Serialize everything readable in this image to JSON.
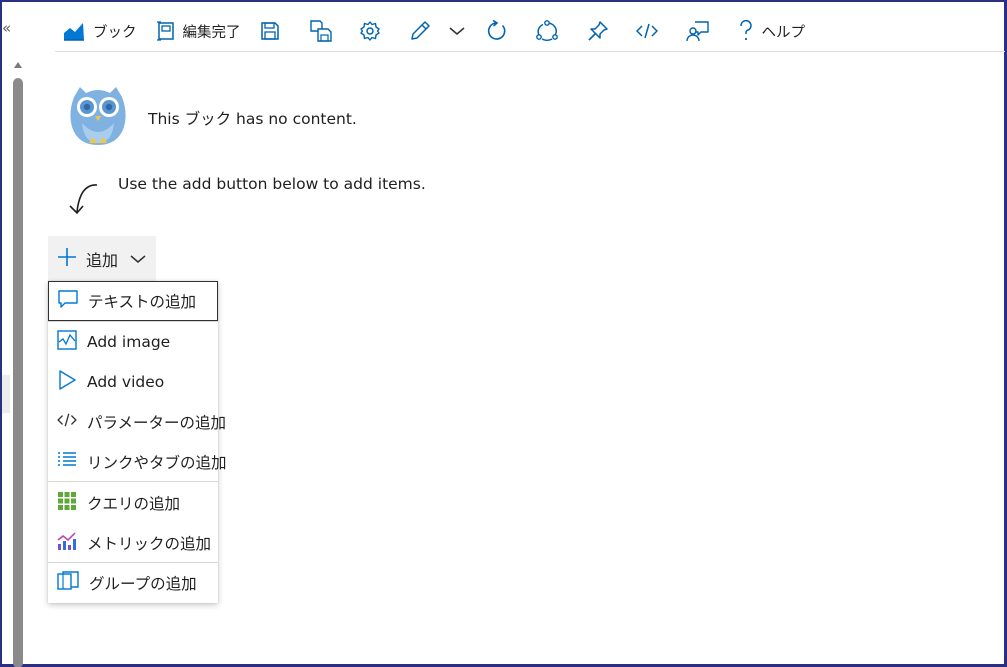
{
  "sidebar": {
    "collapse_glyph": "«"
  },
  "toolbar": {
    "items": [
      {
        "icon": "workbook-chart-icon",
        "label": "ブック"
      },
      {
        "icon": "edit-done-icon",
        "label": "編集完了"
      },
      {
        "icon": "save-icon"
      },
      {
        "icon": "save-as-icon"
      },
      {
        "icon": "settings-gear-icon"
      },
      {
        "icon": "pencil-icon"
      },
      {
        "icon": "chevron-down-icon"
      },
      {
        "icon": "refresh-icon"
      },
      {
        "icon": "share-icon"
      },
      {
        "icon": "pin-icon"
      },
      {
        "icon": "code-icon"
      },
      {
        "icon": "feedback-icon"
      },
      {
        "icon": "help-icon",
        "label": "ヘルプ"
      }
    ]
  },
  "empty_state": {
    "message": "This ブック has no content.",
    "hint": "Use the add button below to add items."
  },
  "add_button": {
    "label": "追加"
  },
  "add_menu": {
    "items": [
      {
        "icon": "text-comment-icon",
        "label": "テキストの追加"
      },
      {
        "icon": "image-icon",
        "label": "Add image"
      },
      {
        "icon": "video-play-icon",
        "label": "Add video"
      },
      {
        "icon": "parameter-code-icon",
        "label": "パラメーターの追加"
      },
      {
        "icon": "links-list-icon",
        "label": "リンクやタブの追加"
      },
      {
        "icon": "query-grid-icon",
        "label": "クエリの追加"
      },
      {
        "icon": "metrics-chart-icon",
        "label": "メトリックの追加"
      },
      {
        "icon": "group-icon",
        "label": "グループの追加"
      }
    ]
  },
  "colors": {
    "border": "#2b2f83",
    "accent_blue": "#0078d4",
    "highlight": "#fff200",
    "query_green": "#5ea93a",
    "metric_purple": "#7a4fd0"
  }
}
